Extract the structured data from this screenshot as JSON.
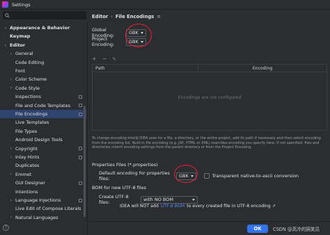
{
  "window": {
    "title": "Settings"
  },
  "sidebar": {
    "items": [
      {
        "label": "Appearance & Behavior",
        "chevron": "›",
        "bold": true
      },
      {
        "label": "Keymap",
        "chevron": "",
        "bold": true
      },
      {
        "label": "Editor",
        "chevron": "⌄",
        "bold": true
      },
      {
        "label": "General",
        "chevron": "›"
      },
      {
        "label": "Code Editing",
        "chevron": ""
      },
      {
        "label": "Font",
        "chevron": ""
      },
      {
        "label": "Color Scheme",
        "chevron": "›"
      },
      {
        "label": "Code Style",
        "chevron": "›"
      },
      {
        "label": "Inspections",
        "chevron": "",
        "badge": true
      },
      {
        "label": "File and Code Templates",
        "chevron": "",
        "badge": true
      },
      {
        "label": "File Encodings",
        "chevron": "",
        "badge": true,
        "selected": true
      },
      {
        "label": "Live Templates",
        "chevron": ""
      },
      {
        "label": "File Types",
        "chevron": ""
      },
      {
        "label": "Android Design Tools",
        "chevron": ""
      },
      {
        "label": "Copyright",
        "chevron": "›",
        "badge": true
      },
      {
        "label": "Inlay Hints",
        "chevron": "›",
        "badge": true
      },
      {
        "label": "Duplicates",
        "chevron": ""
      },
      {
        "label": "Emmet",
        "chevron": "›"
      },
      {
        "label": "GUI Designer",
        "chevron": "",
        "badge": true
      },
      {
        "label": "Intentions",
        "chevron": ""
      },
      {
        "label": "Language Injections",
        "chevron": "›",
        "badge": true
      },
      {
        "label": "Live Edit of Compose Literals",
        "chevron": ""
      },
      {
        "label": "Natural Languages",
        "chevron": "›"
      }
    ]
  },
  "breadcrumb": {
    "parent": "Editor",
    "separator": "›",
    "current": "File Encodings"
  },
  "encoding": {
    "global_label": "Global Encoding:",
    "global_value": "GBK",
    "project_label": "Project Encoding:",
    "project_value": "GBK"
  },
  "table": {
    "toolbar": [
      "+",
      "−",
      "✎"
    ],
    "columns": [
      "Path",
      "Encoding"
    ],
    "empty_text": "Encodings are not configured"
  },
  "info_text": "To change encoding IntelliJ IDEA uses for a file, a directory, or the entire project, add its path if necessary and then select encoding from the encoding list. Built-in file encoding (e.g. JSP, HTML or XML) overrides encoding you specify here. If not specified, files and directories inherit encoding settings from the parent directory or from the Project Encoding.",
  "properties": {
    "section_title": "Properties Files (*.properties)",
    "default_label": "Default encoding for properties files:",
    "default_value": "GBK",
    "transparent_label": "Transparent native-to-ascii conversion"
  },
  "bom": {
    "section_title": "BOM for new UTF-8 files",
    "create_label": "Create UTF-8 files:",
    "create_value": "with NO BOM",
    "note_prefix": "IDEA will NOT add",
    "note_link": "UTF-8 BOM",
    "note_suffix": "to every created file in UTF-8 encoding ↗"
  },
  "footer": {
    "ok_label": "OK",
    "watermark": "CSDN @高冷的搞笑员"
  },
  "colors": {
    "accent": "#3574f0",
    "selection": "#2e436e",
    "annotation": "#e8203b"
  }
}
